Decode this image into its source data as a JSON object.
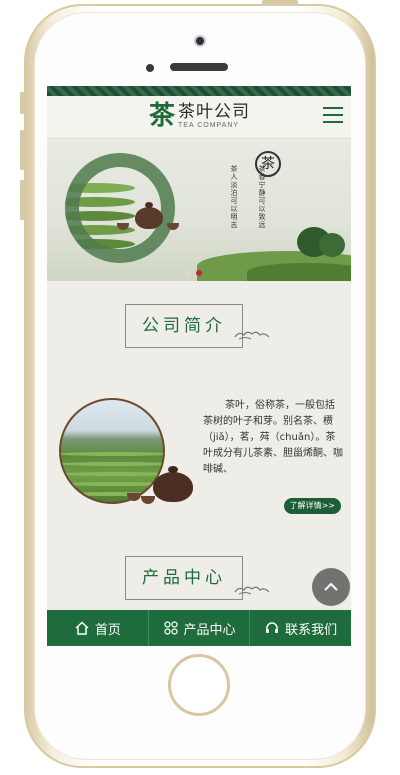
{
  "header": {
    "logo_mark": "茶",
    "logo_cn": "茶叶公司",
    "logo_en": "TEA COMPANY"
  },
  "banner": {
    "seal_char": "茶",
    "poem_lines": [
      "茶香宁静可以致远",
      "茶人淡泊可以明志"
    ],
    "slide_count": 2,
    "active_slide": 2
  },
  "about": {
    "title": "公司简介",
    "text": "茶叶，俗称茶，一般包括茶树的叶子和芽。别名茶、槚（jiǎ），茗，荈（chuǎn）。茶叶成分有儿茶素、胆甾烯酮、咖啡碱、",
    "more_label": "了解详情>>"
  },
  "products": {
    "title": "产品中心"
  },
  "footer_nav": {
    "home": "首页",
    "products": "产品中心",
    "contact": "联系我们"
  },
  "colors": {
    "brand_green": "#1e6b3c",
    "active_dot": "#c2262a"
  }
}
